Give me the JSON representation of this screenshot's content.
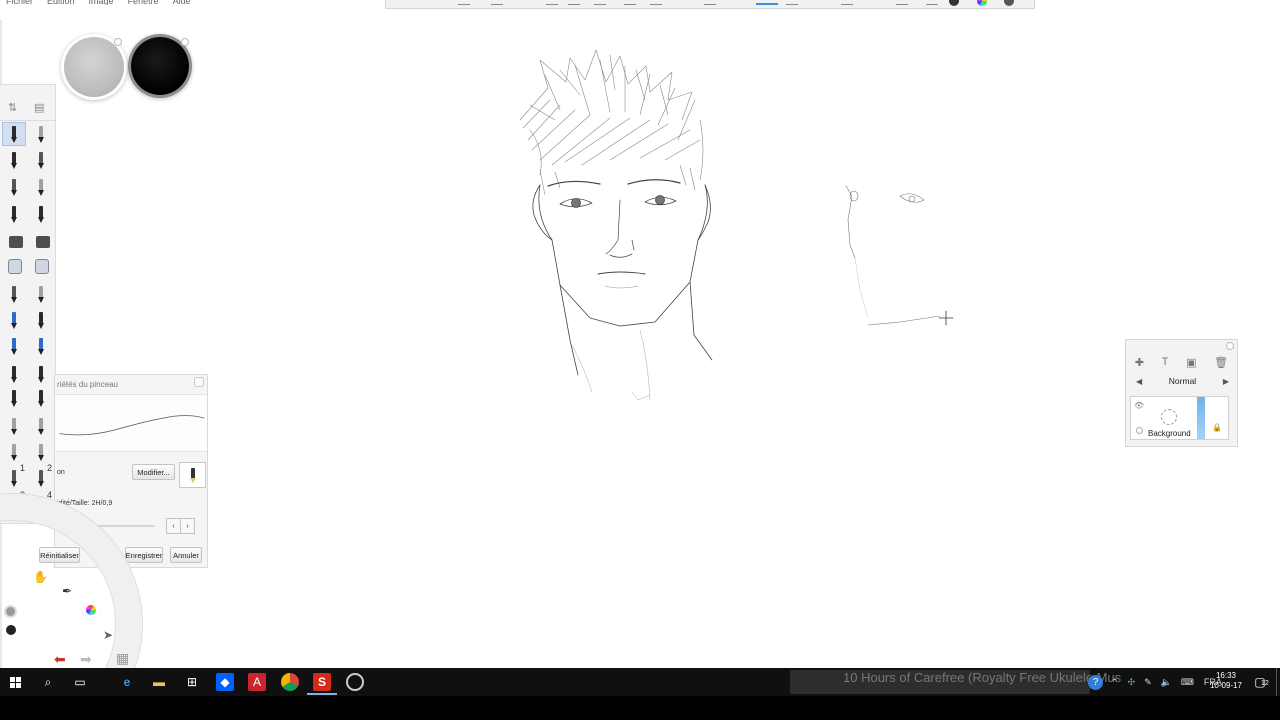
{
  "menubar": {
    "items": [
      "Fichier",
      "Edition",
      "Image",
      "Fenêtre",
      "Aide"
    ]
  },
  "colors": {
    "accent": "#2f80d8",
    "primary_puck": "#bdbdbd",
    "secondary_puck": "#000000",
    "taskbar": "#0f0f0f"
  },
  "brush_library": {
    "slot_numbers": [
      "1",
      "2",
      "3",
      "4"
    ]
  },
  "brush_properties": {
    "title": "riétés du pinceau",
    "on_label": "on",
    "modify_button": "Modifier...",
    "size_label": "idité/Taille: 2H/0,9",
    "prev_arrow": "‹",
    "next_arrow": "›",
    "reset_button": "Réinitialiser",
    "save_button": "Enregistrer",
    "cancel_button": "Annuler"
  },
  "layers": {
    "blend_mode": "Normal",
    "layer_name": "Background",
    "toolbar_icons": [
      "add-layer-icon",
      "text-layer-icon",
      "image-layer-icon",
      "delete-layer-icon"
    ]
  },
  "taskbar": {
    "media_title": "10 Hours of Carefree (Royalty Free Ukulele Mus",
    "language": "FRA",
    "time": "16:33",
    "date": "10-09-17",
    "notification_count": "12",
    "apps": [
      "search-icon",
      "task-view-icon",
      "edge-icon",
      "file-explorer-icon",
      "store-icon",
      "dropbox-icon",
      "acrobat-icon",
      "chrome-icon",
      "sketchbook-icon",
      "obs-icon"
    ]
  }
}
